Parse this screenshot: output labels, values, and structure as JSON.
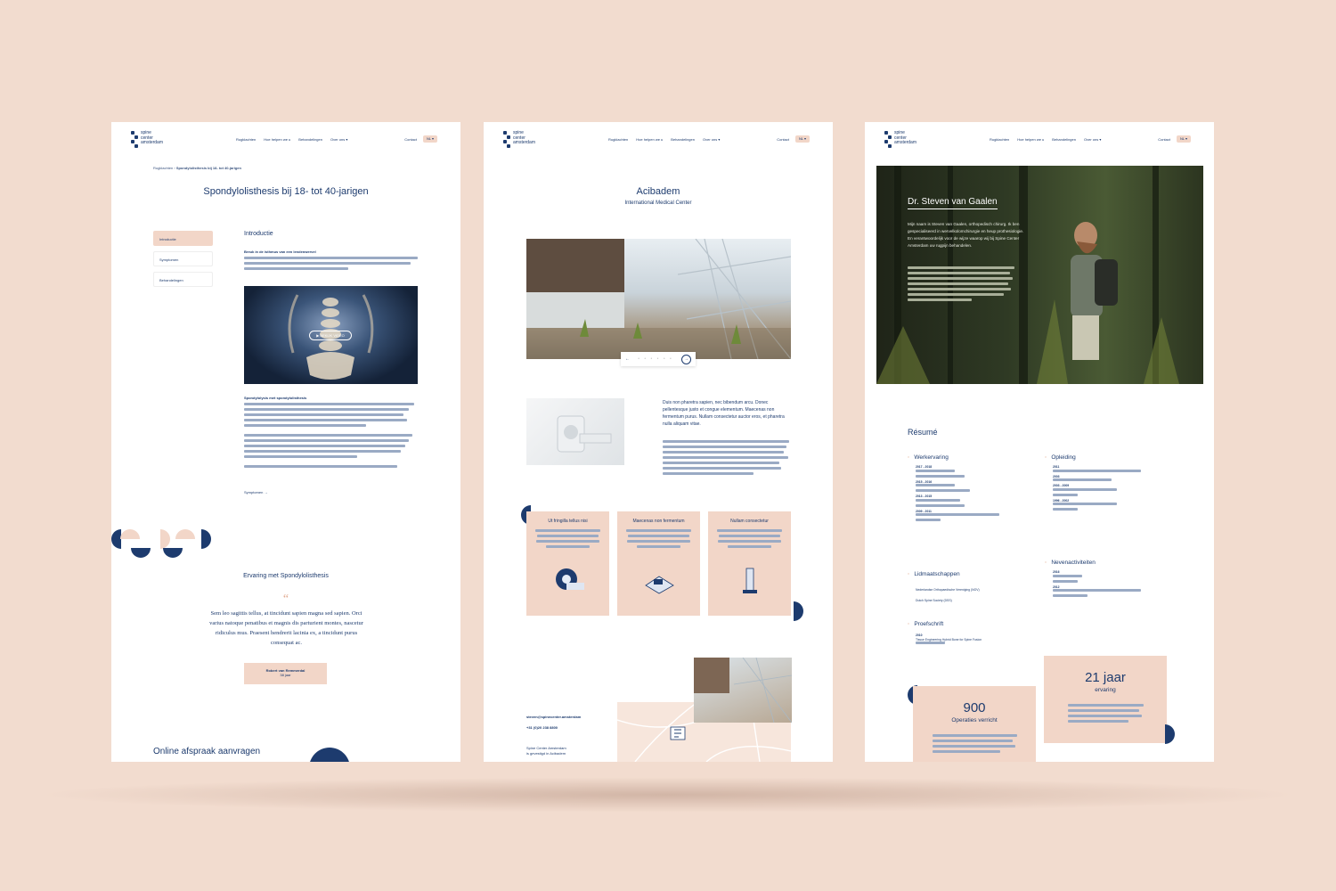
{
  "nav": {
    "logo_line1": "spine",
    "logo_line2": "center",
    "logo_line3": "amsterdam",
    "links": [
      "Rugklachten",
      "Hoe helpen we u",
      "Behandelingen",
      "Over ons"
    ],
    "contact": "Contact",
    "lang": "NL"
  },
  "page1": {
    "breadcrumb_root": "Rugklachten",
    "breadcrumb_current": "Spondylolisthesis bij 18- tot 40-jarigen",
    "title": "Spondylolisthesis bij 18- tot 40-jarigen",
    "toc": [
      "Introductie",
      "Symptomen",
      "Behandelingen"
    ],
    "section_title": "Introductie",
    "intro_heading": "Breuk in de isthmus van een lendenwervel",
    "video_label": "BEKIJK VIDEO",
    "sub_heading": "Spondylolysis met spondylolisthesis",
    "next_link": "Symptomen",
    "experience_title": "Ervaring met Spondylolisthesis",
    "quote_mark": "“",
    "quote": "Sem leo sagittis tellus, at tincidunt sapien magna sed sapien. Orci varius natoque penatibus et magnis dis parturient montes, nascetur ridiculus mus. Praesent hendrerit lacinia ex, a tincidunt purus consequat ac.",
    "quote_author": "Robert van Remmerdal",
    "quote_age": "38 jaar",
    "cta_title": "Online afspraak aanvragen"
  },
  "page2": {
    "title": "Acibadem",
    "subtitle": "International Medical Center",
    "intro_text": "Duis non pharetra sapien, nec bibendum arcu. Donec pellentesque justo et congue elementum. Maecenas non fermentum purus. Nullam consectetur auctor eros, et pharetra nulla aliquam vitae.",
    "cards": [
      "Ut fringilla tellus nisi",
      "Maecenas non fermentum",
      "Nullam consectetur"
    ],
    "email": "steven@spinecenter.amsterdam",
    "phone": "+31 (0)20 238 8800",
    "address_line1": "Spine Center Amsterdam",
    "address_line2": "is gevestigd in Acibadem"
  },
  "page3": {
    "hero_name": "Dr. Steven van Gaalen",
    "hero_text": "Mijn naam is Steven van Gaalen, orthopedisch chirurg. Ik ben gespecialiseerd in wervelkolomchirurgie en heup prothesiologie. En verantwoordelijk voor de wijze waarop wij bij Spine Center Amsterdam uw rugpijn behandelen.",
    "resume_title": "Résumé",
    "sections": {
      "work": "Werkervaring",
      "education": "Opleiding",
      "memberships": "Lidmaatschappen",
      "side": "Nevenactiviteiten",
      "thesis": "Proefschrift"
    },
    "work_years": [
      "2017 - 2018",
      "2015 - 2016",
      "2013 - 2015",
      "2009 - 2011"
    ],
    "edu_years": [
      "2011",
      "2003",
      "2003 - 2009",
      "1996 - 2002"
    ],
    "memberships": [
      "Nederlandse Orthopaedische Vereniging (NOV)",
      "Dutch Spine Society (DSS)"
    ],
    "side_years": [
      "2016",
      "2012"
    ],
    "thesis_year": "2010",
    "thesis_title": "Tissue Engineering Hybrid Bone for Spine Fusion",
    "stat1_value": "900",
    "stat1_label": "Operaties verricht",
    "stat2_value": "21 jaar",
    "stat2_label": "ervaring"
  }
}
